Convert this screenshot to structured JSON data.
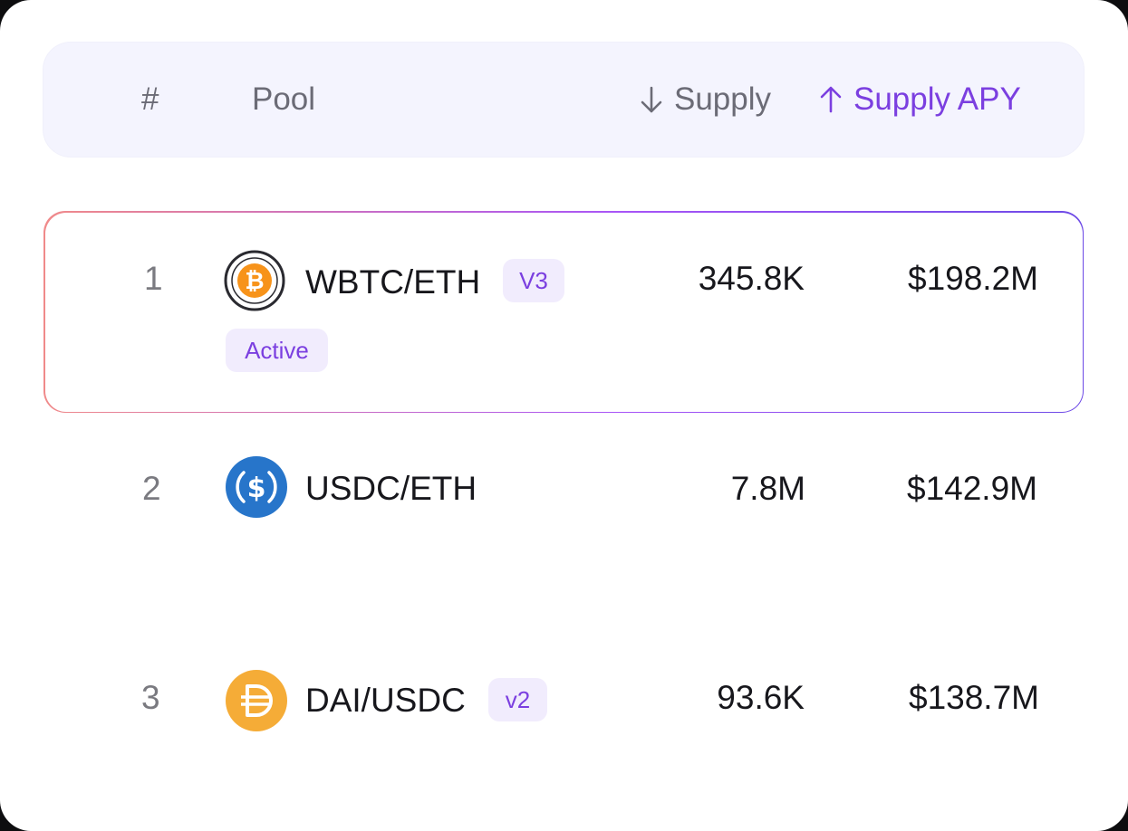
{
  "table": {
    "headers": {
      "rank": "#",
      "pool": "Pool",
      "supply": "Supply",
      "supply_apy": "Supply APY"
    },
    "rows": [
      {
        "rank": "1",
        "pool": "WBTC/ETH",
        "version": "V3",
        "status": "Active",
        "supply": "345.8K",
        "supply_apy": "$198.2M",
        "icon": "bitcoin-icon"
      },
      {
        "rank": "2",
        "pool": "USDC/ETH",
        "version": "",
        "status": "",
        "supply": "7.8M",
        "supply_apy": "$142.9M",
        "icon": "usdc-icon"
      },
      {
        "rank": "3",
        "pool": "DAI/USDC",
        "version": "v2",
        "status": "",
        "supply": "93.6K",
        "supply_apy": "$138.7M",
        "icon": "dai-icon"
      }
    ]
  },
  "colors": {
    "accent": "#7b3fe0",
    "header_bg": "#f4f4fe",
    "badge_bg": "#f1ecfd",
    "bitcoin": "#f7931a",
    "usdc": "#2775ca",
    "dai": "#f5ac37"
  }
}
